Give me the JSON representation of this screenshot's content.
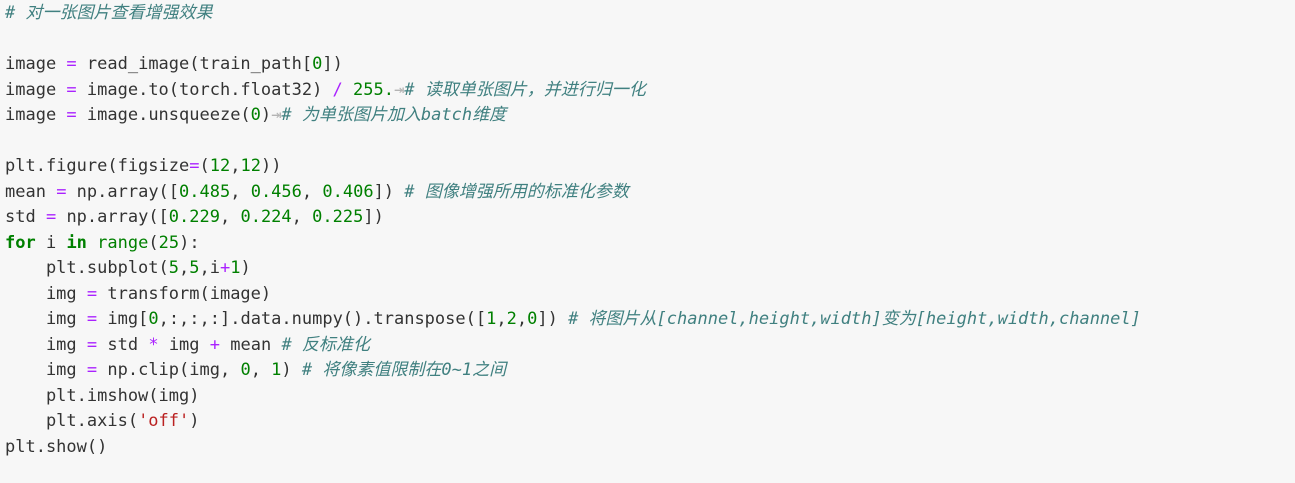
{
  "code_lines": [
    [
      {
        "t": "# 对一张图片查看增强效果",
        "c": "comment"
      }
    ],
    [],
    [
      {
        "t": "image "
      },
      {
        "t": "=",
        "c": "op"
      },
      {
        "t": " read_image(train_path["
      },
      {
        "t": "0",
        "c": "num"
      },
      {
        "t": "])"
      }
    ],
    [
      {
        "t": "image "
      },
      {
        "t": "=",
        "c": "op"
      },
      {
        "t": " image.to(torch.float32) "
      },
      {
        "t": "/",
        "c": "op"
      },
      {
        "t": " "
      },
      {
        "t": "255.",
        "c": "num"
      },
      {
        "t": "⇥",
        "c": "tab"
      },
      {
        "t": "# 读取单张图片，并进行归一化",
        "c": "comment"
      }
    ],
    [
      {
        "t": "image "
      },
      {
        "t": "=",
        "c": "op"
      },
      {
        "t": " image.unsqueeze("
      },
      {
        "t": "0",
        "c": "num"
      },
      {
        "t": ")"
      },
      {
        "t": "⇥",
        "c": "tab"
      },
      {
        "t": "# 为单张图片加入batch维度",
        "c": "comment"
      }
    ],
    [],
    [
      {
        "t": "plt.figure(figsize"
      },
      {
        "t": "=",
        "c": "op"
      },
      {
        "t": "("
      },
      {
        "t": "12",
        "c": "num"
      },
      {
        "t": ","
      },
      {
        "t": "12",
        "c": "num"
      },
      {
        "t": "))"
      }
    ],
    [
      {
        "t": "mean "
      },
      {
        "t": "=",
        "c": "op"
      },
      {
        "t": " np.array(["
      },
      {
        "t": "0.485",
        "c": "num"
      },
      {
        "t": ", "
      },
      {
        "t": "0.456",
        "c": "num"
      },
      {
        "t": ", "
      },
      {
        "t": "0.406",
        "c": "num"
      },
      {
        "t": "]) "
      },
      {
        "t": "# 图像增强所用的标准化参数",
        "c": "comment"
      }
    ],
    [
      {
        "t": "std "
      },
      {
        "t": "=",
        "c": "op"
      },
      {
        "t": " np.array(["
      },
      {
        "t": "0.229",
        "c": "num"
      },
      {
        "t": ", "
      },
      {
        "t": "0.224",
        "c": "num"
      },
      {
        "t": ", "
      },
      {
        "t": "0.225",
        "c": "num"
      },
      {
        "t": "])"
      }
    ],
    [
      {
        "t": "for",
        "c": "kw"
      },
      {
        "t": " i "
      },
      {
        "t": "in",
        "c": "kw"
      },
      {
        "t": " "
      },
      {
        "t": "range",
        "c": "num"
      },
      {
        "t": "("
      },
      {
        "t": "25",
        "c": "num"
      },
      {
        "t": "):"
      }
    ],
    [
      {
        "t": "    plt.subplot("
      },
      {
        "t": "5",
        "c": "num"
      },
      {
        "t": ","
      },
      {
        "t": "5",
        "c": "num"
      },
      {
        "t": ",i"
      },
      {
        "t": "+",
        "c": "op"
      },
      {
        "t": "1",
        "c": "num"
      },
      {
        "t": ")"
      }
    ],
    [
      {
        "t": "    img "
      },
      {
        "t": "=",
        "c": "op"
      },
      {
        "t": " transform(image)"
      }
    ],
    [
      {
        "t": "    img "
      },
      {
        "t": "=",
        "c": "op"
      },
      {
        "t": " img["
      },
      {
        "t": "0",
        "c": "num"
      },
      {
        "t": ",:,:,:].data.numpy().transpose(["
      },
      {
        "t": "1",
        "c": "num"
      },
      {
        "t": ","
      },
      {
        "t": "2",
        "c": "num"
      },
      {
        "t": ","
      },
      {
        "t": "0",
        "c": "num"
      },
      {
        "t": "]) "
      },
      {
        "t": "# 将图片从[channel,height,width]变为[height,width,channel]",
        "c": "comment"
      }
    ],
    [
      {
        "t": "    img "
      },
      {
        "t": "=",
        "c": "op"
      },
      {
        "t": " std "
      },
      {
        "t": "*",
        "c": "op"
      },
      {
        "t": " img "
      },
      {
        "t": "+",
        "c": "op"
      },
      {
        "t": " mean "
      },
      {
        "t": "# 反标准化",
        "c": "comment"
      }
    ],
    [
      {
        "t": "    img "
      },
      {
        "t": "=",
        "c": "op"
      },
      {
        "t": " np.clip(img, "
      },
      {
        "t": "0",
        "c": "num"
      },
      {
        "t": ", "
      },
      {
        "t": "1",
        "c": "num"
      },
      {
        "t": ") "
      },
      {
        "t": "# 将像素值限制在0~1之间",
        "c": "comment"
      }
    ],
    [
      {
        "t": "    plt.imshow(img)"
      }
    ],
    [
      {
        "t": "    plt.axis("
      },
      {
        "t": "'off'",
        "c": "str"
      },
      {
        "t": ")"
      }
    ],
    [
      {
        "t": "plt.show()"
      }
    ]
  ]
}
